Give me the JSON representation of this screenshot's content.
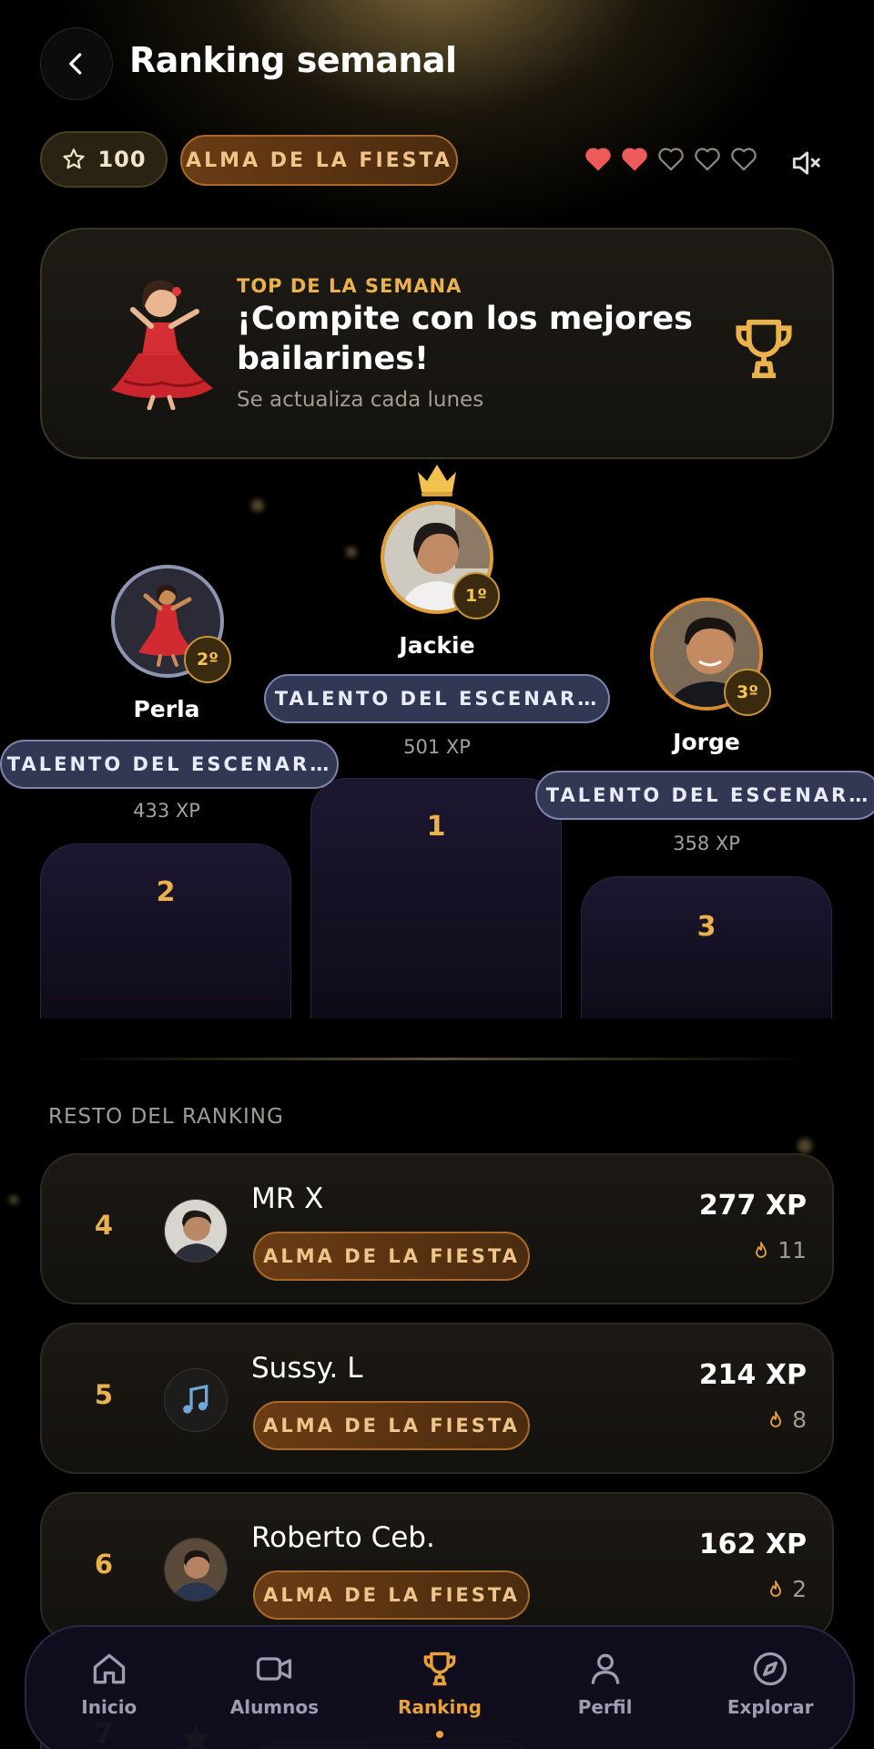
{
  "header": {
    "title": "Ranking semanal"
  },
  "stats": {
    "stars": "100",
    "rank_title": "ALMA DE LA FIESTA",
    "hearts_total": 5,
    "hearts_filled": 2,
    "heart_color": "#ef5b5b"
  },
  "banner": {
    "kicker": "TOP DE LA SEMANA",
    "headline": "¡Compite con los mejores bailarines!",
    "subtitle": "Se actualiza cada lunes"
  },
  "podium": {
    "first": {
      "name": "Jackie",
      "badge": "1º",
      "tag": "TALENTO DEL ESCENAR…",
      "xp": "501 XP",
      "place": "1"
    },
    "second": {
      "name": "Perla",
      "badge": "2º",
      "tag": "TALENTO DEL ESCENAR…",
      "xp": "433 XP",
      "place": "2"
    },
    "third": {
      "name": "Jorge",
      "badge": "3º",
      "tag": "TALENTO DEL ESCENAR…",
      "xp": "358 XP",
      "place": "3"
    }
  },
  "rest": {
    "label": "RESTO DEL RANKING",
    "rows": [
      {
        "rank": "4",
        "name": "MR X",
        "tag": "ALMA DE LA FIESTA",
        "xp": "277 XP",
        "streak": "11"
      },
      {
        "rank": "5",
        "name": "Sussy. L",
        "tag": "ALMA DE LA FIESTA",
        "xp": "214 XP",
        "streak": "8"
      },
      {
        "rank": "6",
        "name": "Roberto Ceb.",
        "tag": "ALMA DE LA FIESTA",
        "xp": "162 XP",
        "streak": "2"
      },
      {
        "rank": "7"
      }
    ]
  },
  "nav": {
    "items": [
      {
        "label": "Inicio",
        "icon": "home-icon"
      },
      {
        "label": "Alumnos",
        "icon": "video-icon"
      },
      {
        "label": "Ranking",
        "icon": "trophy-icon",
        "active": true
      },
      {
        "label": "Perfil",
        "icon": "user-icon"
      },
      {
        "label": "Explorar",
        "icon": "compass-icon"
      }
    ]
  },
  "colors": {
    "accent": "#e9b24c",
    "nav_active": "#e9a13b",
    "tag_blue": "#323753"
  }
}
